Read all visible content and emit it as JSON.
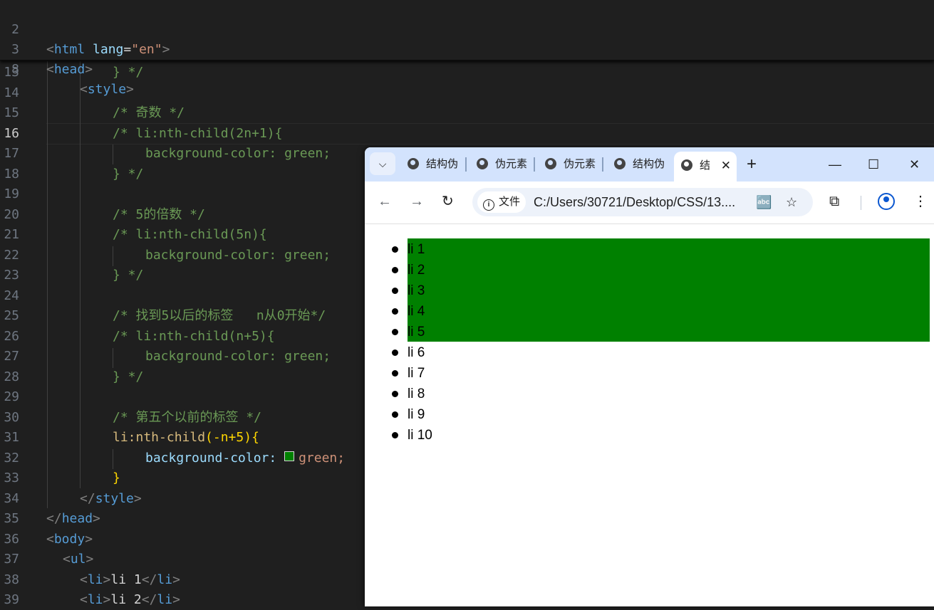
{
  "editor": {
    "sticky_lines": [
      {
        "num": "2",
        "code": "<html lang=\"en\">"
      },
      {
        "num": "3",
        "code": "<head>"
      },
      {
        "num": "8",
        "code": "<style>"
      }
    ],
    "lines": [
      {
        "num": "13",
        "code": "} */"
      },
      {
        "num": "14",
        "code": ""
      },
      {
        "num": "15",
        "code": "/* 奇数 */"
      },
      {
        "num": "16",
        "code": "/* li:nth-child(2n+1){"
      },
      {
        "num": "17",
        "code": "background-color: green;"
      },
      {
        "num": "18",
        "code": "} */"
      },
      {
        "num": "19",
        "code": ""
      },
      {
        "num": "20",
        "code": "/* 5的倍数 */"
      },
      {
        "num": "21",
        "code": "/* li:nth-child(5n){"
      },
      {
        "num": "22",
        "code": "background-color: green;"
      },
      {
        "num": "23",
        "code": "} */"
      },
      {
        "num": "24",
        "code": ""
      },
      {
        "num": "25",
        "code": "/* 找到5以后的标签   n从0开始*/"
      },
      {
        "num": "26",
        "code": "/* li:nth-child(n+5){"
      },
      {
        "num": "27",
        "code": "background-color: green;"
      },
      {
        "num": "28",
        "code": "} */"
      },
      {
        "num": "29",
        "code": ""
      },
      {
        "num": "30",
        "code": "/* 第五个以前的标签 */"
      },
      {
        "num": "31",
        "selector": "li:nth-child",
        "args": "(-n+5)",
        "brace": "{"
      },
      {
        "num": "32",
        "prop": "background-color:",
        "value": "green;"
      },
      {
        "num": "33",
        "code": "}"
      },
      {
        "num": "34",
        "open": "</",
        "tag": "style",
        "close": ">"
      },
      {
        "num": "35",
        "open": "</",
        "tag": "head",
        "close": ">"
      },
      {
        "num": "36",
        "open": "<",
        "tag": "body",
        "close": ">"
      },
      {
        "num": "37",
        "open": "<",
        "tag": "ul",
        "close": ">"
      },
      {
        "num": "38",
        "text": "li 1"
      },
      {
        "num": "39",
        "text": "li 2"
      }
    ],
    "active_line": "16",
    "colors": {
      "background": "#1f1f1f",
      "comment": "#6a9955",
      "tag": "#569cd6",
      "selector": "#d7ba7d",
      "swatch": "#008000"
    }
  },
  "browser": {
    "tabs": [
      {
        "label": "结构伪"
      },
      {
        "label": "伪元素"
      },
      {
        "label": "伪元素"
      },
      {
        "label": "结构伪"
      },
      {
        "label": "结",
        "active": true
      }
    ],
    "tab_search_icon": "chevron-down-icon",
    "new_tab": "+",
    "window_controls": {
      "minimize": "—",
      "maximize": "☐",
      "close": "✕"
    },
    "nav": {
      "back": "←",
      "forward": "→",
      "reload": "↻"
    },
    "site_info_label": "文件",
    "url": "C:/Users/30721/Desktop/CSS/13....",
    "icons": [
      "translate-icon",
      "bookmark-star-icon",
      "extensions-icon",
      "profile-icon",
      "menu-dots-icon"
    ],
    "list_items": [
      "li 1",
      "li 2",
      "li 3",
      "li 4",
      "li 5",
      "li 6",
      "li 7",
      "li 8",
      "li 9",
      "li 10"
    ],
    "highlighted_count": 5,
    "highlight_color": "#008000"
  }
}
